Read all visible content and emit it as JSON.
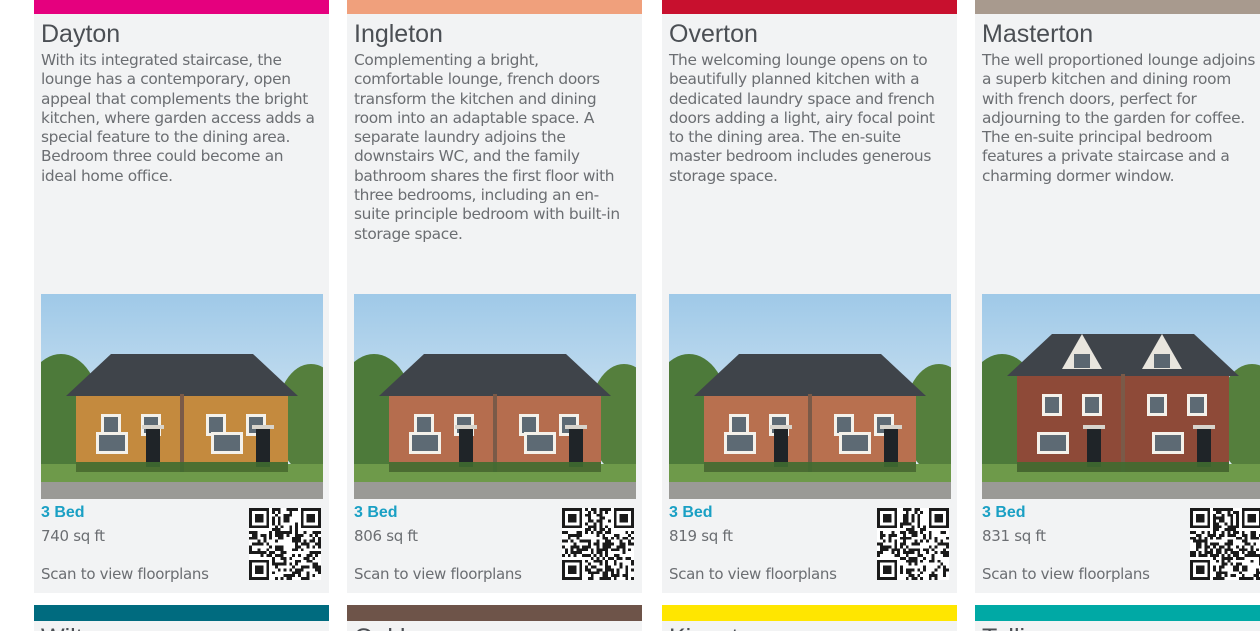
{
  "cards": [
    {
      "name": "Dayton",
      "description": "With its integrated staircase, the lounge has a contemporary, open appeal that complements the bright kitchen, where garden access adds a special feature to the dining area. Bedroom three could become an ideal home office.",
      "beds": "3 Bed",
      "sqft": "740 sq ft",
      "scan": "Scan to view floorplans",
      "accent": "#e5007e",
      "brick": "#c48a3e"
    },
    {
      "name": "Ingleton",
      "description": "Complementing a bright, comfortable lounge, french doors transform the kitchen and dining room into an adaptable space. A separate laundry adjoins the downstairs WC, and the family bathroom shares the first floor with three bedrooms, including an en-suite principle bedroom with built-in storage space.",
      "beds": "3 Bed",
      "sqft": "806 sq ft",
      "scan": "Scan to view floorplans",
      "accent": "#f0a07c",
      "brick": "#b56d4e"
    },
    {
      "name": "Overton",
      "description": "The welcoming lounge opens on to beautifully planned kitchen with a dedicated laundry space and french doors adding a light, airy focal point to the dining area. The en-suite master bedroom includes generous storage space.",
      "beds": "3 Bed",
      "sqft": "819 sq ft",
      "scan": "Scan to view floorplans",
      "accent": "#c8102e",
      "brick": "#b8704f"
    },
    {
      "name": "Masterton",
      "description": "The well proportioned lounge adjoins a superb kitchen and dining room with french doors, perfect for adjourning to the garden for coffee. The en-suite principal bedroom features a private staircase and a charming dormer window.",
      "beds": "3 Bed",
      "sqft": "831 sq ft",
      "scan": "Scan to view floorplans",
      "accent": "#a89a8e",
      "brick": "#8e4a38"
    }
  ],
  "next_row": {
    "accents": [
      "#006b7f",
      "#6e5449",
      "#ffe600",
      "#00a9a5"
    ],
    "names": [
      "Wilton",
      "Oakham",
      "Kingston",
      "Tallis"
    ]
  }
}
